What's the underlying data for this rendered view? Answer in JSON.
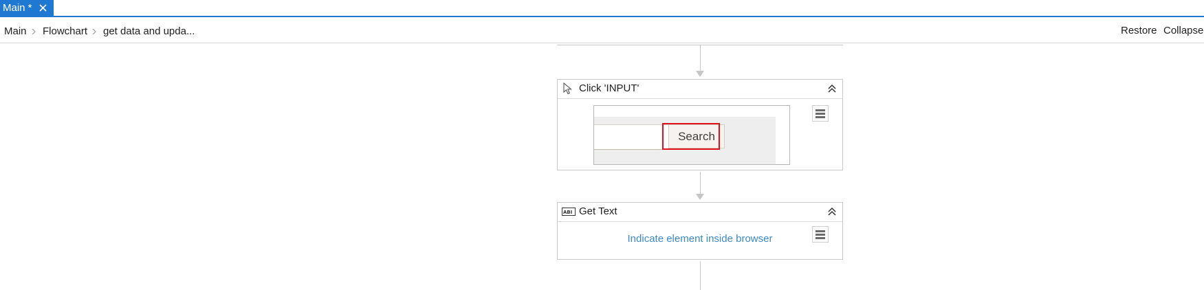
{
  "tabs": [
    {
      "label": "Main *",
      "active": true
    }
  ],
  "breadcrumb": [
    "Main",
    "Flowchart",
    "get data and upda..."
  ],
  "header_actions": {
    "restore": "Restore",
    "collapse": "Collapse"
  },
  "activities": [
    {
      "title": "Click 'INPUT'",
      "icon": "pointer-icon",
      "preview": {
        "button_text": "Search"
      }
    },
    {
      "title": "Get Text",
      "icon": "get-text-icon",
      "hint": "Indicate element inside browser"
    }
  ],
  "colors": {
    "accent": "#1f78d1",
    "link": "#3a88c8",
    "highlight": "#e0101a"
  }
}
